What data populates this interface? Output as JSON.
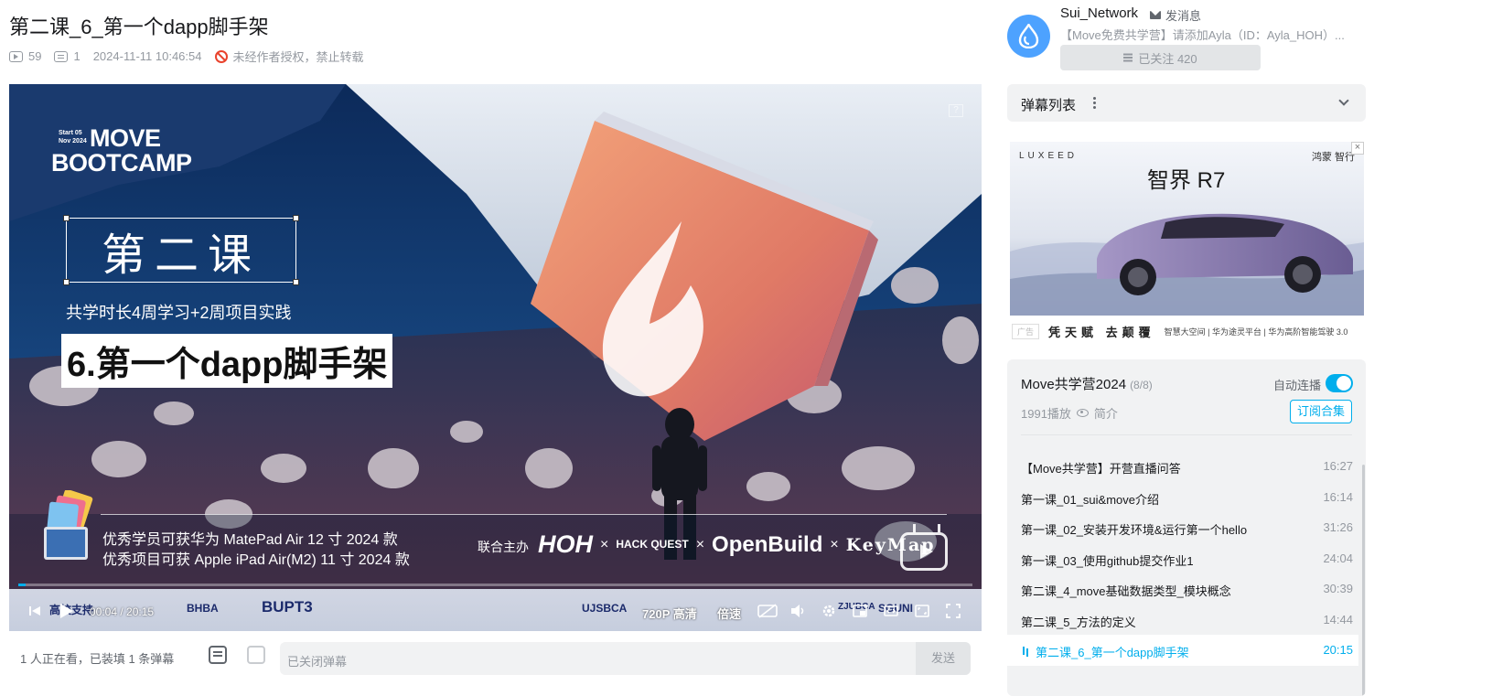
{
  "video": {
    "title": "第二课_6_第一个dapp脚手架",
    "plays": "59",
    "danmaku_count": "1",
    "publish_time": "2024-11-11 10:46:54",
    "copyright": "未经作者授权，禁止转载"
  },
  "frame": {
    "brand_line1": "MOVE",
    "brand_line2": "BOOTCAMP",
    "brand_small": "Start 05 Nov 2024",
    "lesson": "第二课",
    "lesson_sub": "共学时长4周学习+2周项目实践",
    "topic": "6.第一个dapp脚手架",
    "prize1": "优秀学员可获华为 MatePad Air 12 寸 2024 款",
    "prize2": "优秀项目可获 Apple iPad Air(M2) 11 寸 2024 款",
    "cohost_label": "联合主办",
    "logos": [
      "HOH",
      "HACK QUEST",
      "OpenBuild",
      "KeyMap"
    ],
    "sponsors": [
      "高校支持",
      "BHBA",
      "BUPT3",
      "UJSBCA",
      "ZJUBCA",
      "SGUNI"
    ]
  },
  "player": {
    "time_current": "00:04",
    "time_total": "20:15",
    "quality": "720P 高清",
    "speed": "倍速",
    "progress": 0.004
  },
  "below_bar": {
    "viewers": "1 人正在看，已装填 1 条弹幕",
    "danmaku_placeholder": "已关闭弹幕",
    "send": "发送"
  },
  "uploader": {
    "name": "Sui_Network",
    "message": "发消息",
    "desc": "【Move免费共学营】请添加Ayla（ID：Ayla_HOH）...",
    "follow": "已关注 420"
  },
  "danmaku_panel": {
    "title": "弹幕列表"
  },
  "ad": {
    "brand_text": "LUXEED",
    "partner": "鸿蒙 智行",
    "model": "智界 R7",
    "tag": "广告",
    "words": "凭天赋 去颠覆",
    "slogan": "智慧大空间 | 华为途灵平台 | 华为高阶智能驾驶 3.0"
  },
  "playlist": {
    "title": "Move共学营2024",
    "count": "(8/8)",
    "autoplay_label": "自动连播",
    "plays": "1991播放",
    "intro": "简介",
    "subscribe": "订阅合集",
    "items": [
      {
        "title": "【Move共学营】开营直播问答",
        "duration": "16:27"
      },
      {
        "title": "第一课_01_sui&move介绍",
        "duration": "16:14"
      },
      {
        "title": "第一课_02_安装开发环境&运行第一个hello",
        "duration": "31:26"
      },
      {
        "title": "第一课_03_使用github提交作业1",
        "duration": "24:04"
      },
      {
        "title": "第二课_4_move基础数据类型_模块概念",
        "duration": "30:39"
      },
      {
        "title": "第二课_5_方法的定义",
        "duration": "14:44"
      },
      {
        "title": "第二课_6_第一个dapp脚手架",
        "duration": "20:15"
      }
    ]
  }
}
